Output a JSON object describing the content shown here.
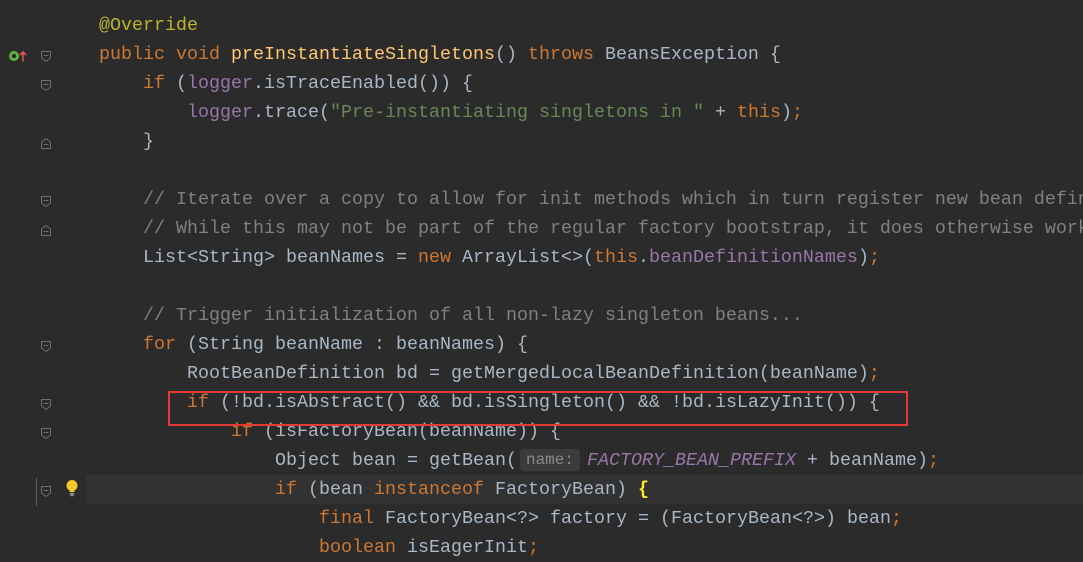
{
  "theme": {
    "background": "#2B2B2B",
    "text": "#A9B7C6",
    "keyword": "#CC7832",
    "annotation": "#BBB529",
    "method_declaration": "#FFC66D",
    "string": "#6A8759",
    "comment": "#808080",
    "field": "#9876AA",
    "matched_brace": "#FFEF28",
    "hint_background": "#3B3B3B",
    "hint_text": "#8A8A8A",
    "current_line": "#323232",
    "annotation_box": "#E53935"
  },
  "gutter": {
    "icons": [
      "implements-method-icon",
      "fold-start-icon",
      "fold-end-icon",
      "lightbulb-icon"
    ]
  },
  "editor": {
    "lines": [
      [
        "@Override"
      ],
      [
        "public void ",
        "preInstantiateSingletons",
        "() ",
        "throws",
        " BeansException {"
      ],
      [
        "if",
        " (",
        "logger",
        ".isTraceEnabled()) {"
      ],
      [
        "logger",
        ".trace(",
        "\"Pre-instantiating singletons in \"",
        " + ",
        "this",
        ")",
        ";"
      ],
      [
        "}"
      ],
      [],
      [
        "// Iterate over a copy to allow for init methods which in turn register new bean defin"
      ],
      [
        "// While this may not be part of the regular factory bootstrap, it does otherwise work"
      ],
      [
        "List<String> beanNames = ",
        "new",
        " ArrayList<>(",
        "this",
        ".",
        "beanDefinitionNames",
        ")",
        ";"
      ],
      [],
      [
        "// Trigger initialization of all non-lazy singleton beans..."
      ],
      [
        "for",
        " (String beanName : beanNames) {"
      ],
      [
        "RootBeanDefinition bd = getMergedLocalBeanDefinition(beanName)",
        ";"
      ],
      [
        "if",
        " (!bd.isAbstract() && bd.isSingleton() && !bd.isLazyInit()) {"
      ],
      [
        "if",
        " (isFactoryBean(beanName)) {"
      ],
      [
        "Object bean = getBean(",
        "name:",
        "FACTORY_BEAN_PREFIX",
        " + beanName)",
        ";"
      ],
      [
        "if",
        " (bean ",
        "instanceof",
        " FactoryBean) ",
        "{"
      ],
      [
        "final",
        " FactoryBean<?> factory = (FactoryBean<?>) bean",
        ";"
      ],
      [
        "boolean",
        " isEagerInit",
        ";"
      ]
    ]
  }
}
